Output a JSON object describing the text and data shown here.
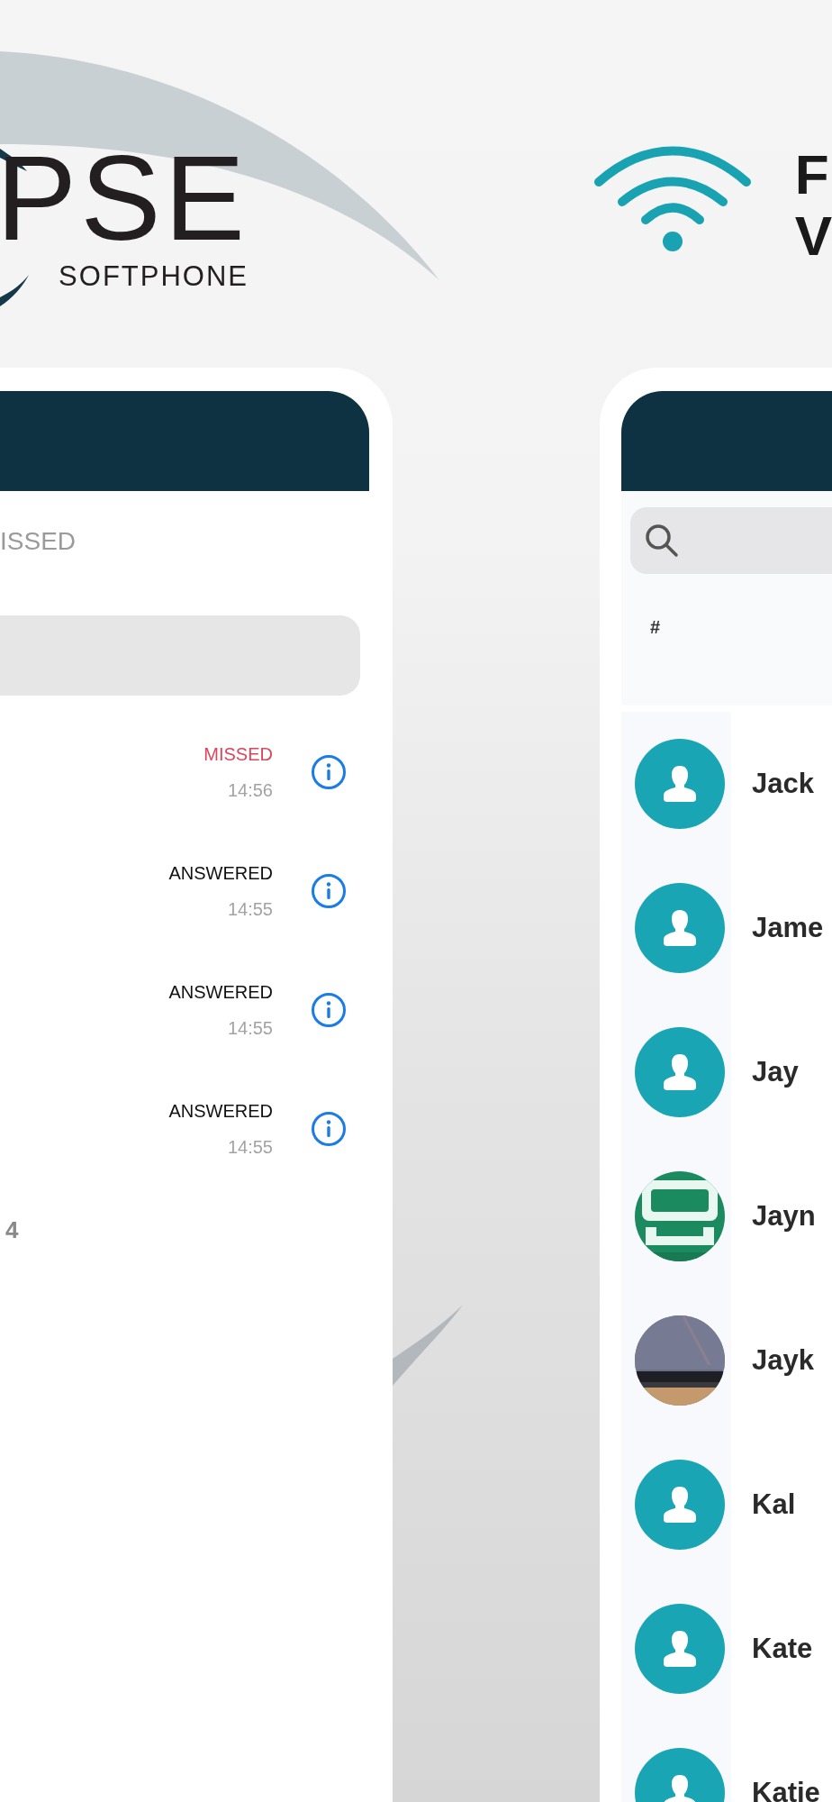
{
  "logo": {
    "wordmark": "PSE",
    "tagline": "SOFTPHONE"
  },
  "headline": {
    "lines": [
      "F",
      "V"
    ]
  },
  "recents_phone": {
    "tab": "ISSED",
    "calls": [
      {
        "status": "MISSED",
        "missed": true,
        "time": "14:56"
      },
      {
        "status": "ANSWERED",
        "missed": false,
        "time": "14:55"
      },
      {
        "status": "ANSWERED",
        "missed": false,
        "time": "14:55"
      },
      {
        "status": "ANSWERED",
        "missed": false,
        "time": "14:55"
      }
    ],
    "footer": "4"
  },
  "contacts_phone": {
    "section": "#",
    "contacts": [
      {
        "name": "Jack",
        "kind": "default"
      },
      {
        "name": "Jame",
        "kind": "default"
      },
      {
        "name": "Jay",
        "kind": "default"
      },
      {
        "name": "Jayn",
        "kind": "logo"
      },
      {
        "name": "Jayk"
      },
      {
        "name": "Kal",
        "kind": "default"
      },
      {
        "name": "Kate",
        "kind": "default"
      },
      {
        "name": "Katie",
        "kind": "default"
      }
    ]
  }
}
